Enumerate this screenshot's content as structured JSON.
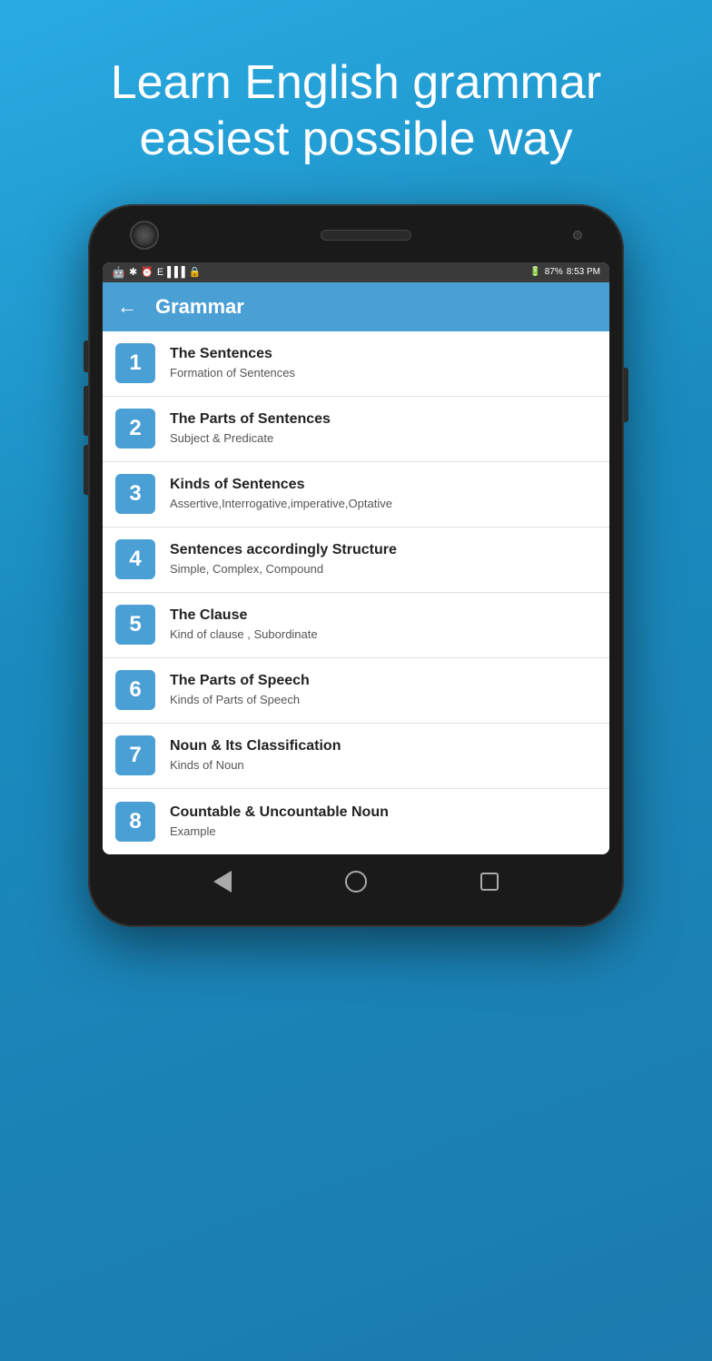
{
  "hero": {
    "headline": "Learn English grammar easiest possible way"
  },
  "status_bar": {
    "bluetooth": "✱",
    "alarm": "⏰",
    "signal": "E▐▐▐",
    "lock": "🔒",
    "battery_percent": "87%",
    "time": "8:53 PM"
  },
  "app_header": {
    "back_label": "←",
    "title": "Grammar"
  },
  "list_items": [
    {
      "number": "1",
      "title": "The Sentences",
      "subtitle": "Formation of Sentences"
    },
    {
      "number": "2",
      "title": "The Parts of Sentences",
      "subtitle": "Subject & Predicate"
    },
    {
      "number": "3",
      "title": "Kinds of Sentences",
      "subtitle": "Assertive,Interrogative,imperative,Optative"
    },
    {
      "number": "4",
      "title": "Sentences accordingly Structure",
      "subtitle": "Simple, Complex, Compound"
    },
    {
      "number": "5",
      "title": "The Clause",
      "subtitle": "Kind of clause , Subordinate"
    },
    {
      "number": "6",
      "title": "The Parts of Speech",
      "subtitle": "Kinds of Parts of Speech"
    },
    {
      "number": "7",
      "title": "Noun & Its Classification",
      "subtitle": "Kinds of Noun"
    },
    {
      "number": "8",
      "title": "Countable & Uncountable Noun",
      "subtitle": "Example"
    }
  ]
}
